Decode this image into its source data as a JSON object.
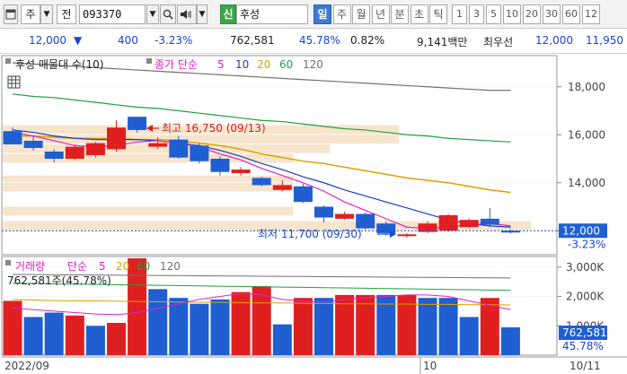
{
  "toolbar": {
    "window_icon": "chart-window-icon",
    "chart_type": "주",
    "period": "전",
    "code": "093370",
    "stock_name_badge": "신",
    "stock_name": "후성",
    "timeframes": [
      {
        "label": "일",
        "selected": true
      },
      {
        "label": "주",
        "selected": false
      },
      {
        "label": "월",
        "selected": false
      },
      {
        "label": "년",
        "selected": false
      },
      {
        "label": "분",
        "selected": false
      },
      {
        "label": "초",
        "selected": false
      },
      {
        "label": "틱",
        "selected": false
      }
    ],
    "intervals": [
      "1",
      "3",
      "5",
      "10",
      "20",
      "30",
      "60",
      "12"
    ]
  },
  "quote": {
    "price": "12,000",
    "change": "400",
    "change_pct": "-3.23%",
    "volume": "762,581",
    "volume_ratio": "45.78%",
    "turnover": "0.82%",
    "amount": "9,141백만",
    "priority_label": "최우선",
    "bid": "12,000",
    "ask": "11,950"
  },
  "legend_price": {
    "title": "후성 매물대 수(10)",
    "ma_label": "종가 단순",
    "periods": [
      "5",
      "10",
      "20",
      "60",
      "120"
    ]
  },
  "legend_volume": {
    "title": "거래량",
    "ma_label": "단순",
    "periods": [
      "5",
      "20",
      "60",
      "120"
    ],
    "current_value": "762,581주(45.78%)"
  },
  "annotations": {
    "high": "최고 16,750 (09/13)",
    "low": "최저 11,700 (09/30)"
  },
  "axis": {
    "date_left": "2022/09",
    "date_mid": "10",
    "date_right": "10/11",
    "price_tag": "12,000",
    "price_tag_pct": "-3.23%",
    "volume_tag": "762,581",
    "volume_tag_pct": "45.78%"
  },
  "colors": {
    "up": "#e02020",
    "down": "#1f5fd1",
    "ma5": "#e020c8",
    "ma10": "#1a3fb8",
    "ma20": "#e0a000",
    "ma60": "#20a040",
    "ma120": "#707070",
    "volume_profile": "#f7e4cc"
  },
  "chart_data": [
    {
      "type": "candlestick",
      "ylim": [
        11000,
        19300
      ],
      "yticks": [
        12000,
        14000,
        16000,
        18000
      ],
      "ytick_labels": [
        "12,000",
        "14,000",
        "16,000",
        "18,000"
      ],
      "candles": [
        {
          "o": 16150,
          "h": 16300,
          "l": 15800,
          "c": 15600,
          "dir": "down"
        },
        {
          "o": 15750,
          "h": 15950,
          "l": 15350,
          "c": 15450,
          "dir": "down"
        },
        {
          "o": 15300,
          "h": 15400,
          "l": 14850,
          "c": 15000,
          "dir": "down"
        },
        {
          "o": 15000,
          "h": 15600,
          "l": 14950,
          "c": 15500,
          "dir": "up"
        },
        {
          "o": 15150,
          "h": 15700,
          "l": 15050,
          "c": 15650,
          "dir": "up"
        },
        {
          "o": 15400,
          "h": 16600,
          "l": 15300,
          "c": 16300,
          "dir": "up"
        },
        {
          "o": 16750,
          "h": 16750,
          "l": 16100,
          "c": 16200,
          "dir": "down"
        },
        {
          "o": 15500,
          "h": 15900,
          "l": 15400,
          "c": 15650,
          "dir": "up"
        },
        {
          "o": 15800,
          "h": 15950,
          "l": 15000,
          "c": 15050,
          "dir": "down"
        },
        {
          "o": 15550,
          "h": 15650,
          "l": 14800,
          "c": 14900,
          "dir": "down"
        },
        {
          "o": 15000,
          "h": 15100,
          "l": 14300,
          "c": 14450,
          "dir": "down"
        },
        {
          "o": 14400,
          "h": 14650,
          "l": 14300,
          "c": 14550,
          "dir": "up"
        },
        {
          "o": 14200,
          "h": 14250,
          "l": 13850,
          "c": 13900,
          "dir": "down"
        },
        {
          "o": 13700,
          "h": 14100,
          "l": 13650,
          "c": 13900,
          "dir": "up"
        },
        {
          "o": 13850,
          "h": 13950,
          "l": 13150,
          "c": 13200,
          "dir": "down"
        },
        {
          "o": 13000,
          "h": 13050,
          "l": 12350,
          "c": 12550,
          "dir": "down"
        },
        {
          "o": 12500,
          "h": 12800,
          "l": 12450,
          "c": 12700,
          "dir": "up"
        },
        {
          "o": 12700,
          "h": 12750,
          "l": 12050,
          "c": 12100,
          "dir": "down"
        },
        {
          "o": 12300,
          "h": 12400,
          "l": 11800,
          "c": 11900,
          "dir": "down"
        },
        {
          "o": 11800,
          "h": 11900,
          "l": 11700,
          "c": 11850,
          "dir": "up"
        },
        {
          "o": 11950,
          "h": 12400,
          "l": 11900,
          "c": 12300,
          "dir": "up"
        },
        {
          "o": 12000,
          "h": 12700,
          "l": 11950,
          "c": 12650,
          "dir": "up"
        },
        {
          "o": 12150,
          "h": 12500,
          "l": 12100,
          "c": 12450,
          "dir": "up"
        },
        {
          "o": 12500,
          "h": 12950,
          "l": 12150,
          "c": 12250,
          "dir": "down"
        },
        {
          "o": 12000,
          "h": 12050,
          "l": 11900,
          "c": 12000,
          "dir": "down"
        }
      ],
      "ma5": [
        16100,
        15950,
        15750,
        15550,
        15500,
        15550,
        15700,
        15750,
        15650,
        15500,
        15200,
        14950,
        14600,
        14300,
        14000,
        13650,
        13200,
        12850,
        12500,
        12150,
        12100,
        12150,
        12250,
        12300,
        12200
      ],
      "ma10": [
        16200,
        16100,
        15950,
        15850,
        15800,
        15800,
        15800,
        15750,
        15650,
        15550,
        15350,
        15100,
        14800,
        14550,
        14250,
        14000,
        13700,
        13450,
        13200,
        12950,
        12700,
        12450,
        12300,
        12200,
        12150
      ],
      "ma20": [
        15950,
        15950,
        15900,
        15850,
        15850,
        15850,
        15800,
        15800,
        15750,
        15650,
        15550,
        15400,
        15200,
        15050,
        14900,
        14800,
        14650,
        14500,
        14350,
        14200,
        14100,
        14000,
        13850,
        13700,
        13600
      ],
      "ma60": [
        17700,
        17600,
        17550,
        17450,
        17350,
        17250,
        17150,
        17100,
        17000,
        16900,
        16800,
        16700,
        16600,
        16550,
        16450,
        16350,
        16250,
        16200,
        16100,
        16000,
        15950,
        15850,
        15800,
        15750,
        15700
      ],
      "ma120": [
        19000,
        18950,
        18900,
        18850,
        18800,
        18750,
        18700,
        18650,
        18600,
        18550,
        18500,
        18450,
        18400,
        18350,
        18300,
        18250,
        18200,
        18150,
        18100,
        18050,
        18000,
        17950,
        17900,
        17850,
        17850
      ],
      "volume_profile": [
        {
          "low": 12000,
          "high": 12400,
          "strength": 1.0
        },
        {
          "low": 12600,
          "high": 13000,
          "strength": 0.55
        },
        {
          "low": 13600,
          "high": 14000,
          "strength": 0.55
        },
        {
          "low": 14000,
          "high": 14300,
          "strength": 0.55
        },
        {
          "low": 14800,
          "high": 15200,
          "strength": 0.55
        },
        {
          "low": 15200,
          "high": 15600,
          "strength": 0.62
        },
        {
          "low": 15600,
          "high": 16000,
          "strength": 0.75
        },
        {
          "low": 16000,
          "high": 16400,
          "strength": 0.75
        }
      ]
    },
    {
      "type": "bar",
      "series_name": "거래량",
      "ylim": [
        0,
        3300
      ],
      "yticks": [
        1000,
        2000,
        3000
      ],
      "ytick_labels": [
        "1,000K",
        "2,000K",
        "3,000K"
      ],
      "values": [
        1850,
        1300,
        1450,
        1350,
        1000,
        1100,
        3650,
        2250,
        1950,
        1750,
        1900,
        2150,
        2350,
        1050,
        1950,
        1950,
        2050,
        2050,
        2050,
        2050,
        1950,
        1950,
        1300,
        1950,
        950
      ],
      "directions": [
        "up",
        "down",
        "down",
        "up",
        "down",
        "up",
        "up",
        "down",
        "down",
        "down",
        "down",
        "up",
        "up",
        "down",
        "up",
        "down",
        "up",
        "up",
        "down",
        "up",
        "down",
        "down",
        "down",
        "up",
        "down"
      ],
      "ma5": [
        1600,
        1550,
        1500,
        1450,
        1400,
        1380,
        1450,
        1600,
        1750,
        1900,
        2000,
        2100,
        2050,
        1900,
        1850,
        1800,
        1900,
        1950,
        2000,
        2050,
        2050,
        2000,
        1850,
        1700,
        1550
      ],
      "ma20": [
        1900,
        1880,
        1860,
        1850,
        1850,
        1840,
        1830,
        1820,
        1810,
        1800,
        1800,
        1790,
        1780,
        1780,
        1770,
        1760,
        1750,
        1750,
        1740,
        1740,
        1730,
        1730,
        1720,
        1720,
        1710
      ],
      "ma60": [
        2450,
        2440,
        2430,
        2420,
        2410,
        2400,
        2390,
        2380,
        2370,
        2360,
        2350,
        2340,
        2330,
        2320,
        2310,
        2300,
        2290,
        2280,
        2270,
        2260,
        2250,
        2240,
        2230,
        2220,
        2210
      ],
      "ma120": [
        2750,
        2745,
        2740,
        2735,
        2730,
        2725,
        2720,
        2715,
        2710,
        2705,
        2700,
        2695,
        2690,
        2685,
        2680,
        2675,
        2670,
        2665,
        2660,
        2655,
        2650,
        2645,
        2640,
        2635,
        2630
      ]
    }
  ]
}
